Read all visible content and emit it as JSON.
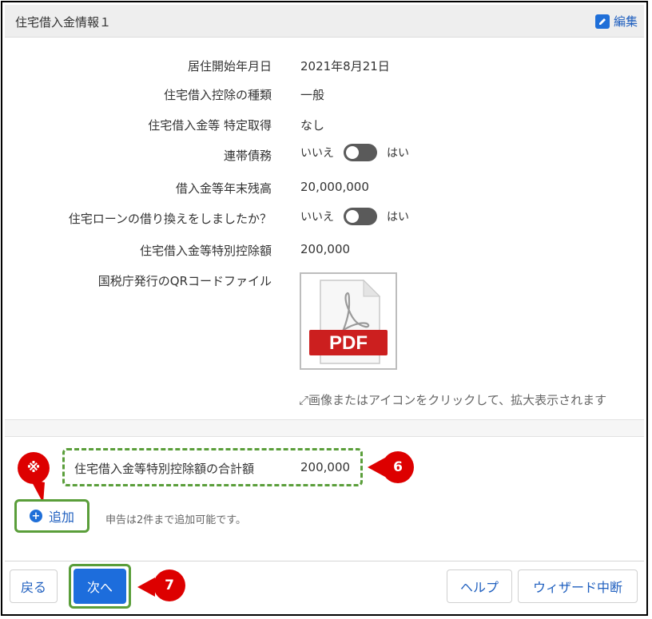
{
  "header": {
    "title": "住宅借入金情報１",
    "edit_label": "編集"
  },
  "fields": [
    {
      "label": "居住開始年月日",
      "value": "2021年8月21日"
    },
    {
      "label": "住宅借入控除の種類",
      "value": "一般"
    },
    {
      "label": "住宅借入金等 特定取得",
      "value": "なし"
    },
    {
      "label": "連帯債務"
    },
    {
      "label": "借入金等年末残高",
      "value": "20,000,000"
    },
    {
      "label": "住宅ローンの借り換えをしましたか？"
    },
    {
      "label": "住宅借入金等特別控除額",
      "value": "200,000"
    },
    {
      "label": "国税庁発行のQRコードファイル"
    }
  ],
  "toggles": {
    "no_label": "いいえ",
    "yes_label": "はい",
    "joint_debt_state": "いいえ",
    "refinance_state": "いいえ"
  },
  "pdf": {
    "label": "PDF"
  },
  "hint": "画像またはアイコンをクリックして、拡大表示されます",
  "total": {
    "label": "住宅借入金等特別控除額の合計額",
    "value": "200,000"
  },
  "add": {
    "label": "追加",
    "note": "申告は2件まで追加可能です。"
  },
  "annotations": {
    "mark": "※",
    "step6": "6",
    "step7": "7"
  },
  "footer": {
    "back": "戻る",
    "next": "次へ",
    "help": "ヘルプ",
    "abort": "ウィザード中断"
  },
  "colors": {
    "accent": "#1d6ddc",
    "highlight": "#5a9e3a",
    "badge": "#dd0000",
    "pdf_red": "#cc1f1f"
  }
}
